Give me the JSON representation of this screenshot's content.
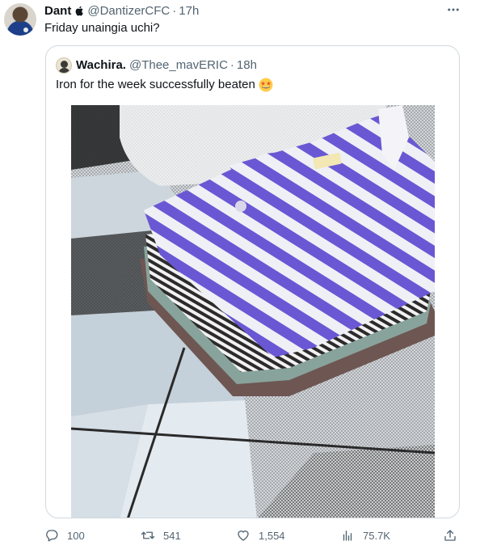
{
  "tweet": {
    "author_name": "Dant",
    "author_handle": "@DantizerCFC",
    "time": "17h",
    "separator": "·",
    "text": "Friday unaingia uchi?",
    "avatar_icon": "profile-photo-icon",
    "badge_icon": "apple-icon",
    "more_icon": "more-options-icon"
  },
  "quote": {
    "author_name": "Wachira.",
    "author_handle": "@Thee_mavERIC",
    "time": "18h",
    "separator": "·",
    "text": "Iron for the week successfully beaten",
    "emoji": "star-struck-emoji",
    "photo": "folded-ironed-shirts-photo"
  },
  "actions": {
    "reply": {
      "icon": "reply-icon",
      "count": "100"
    },
    "retweet": {
      "icon": "retweet-icon",
      "count": "541"
    },
    "like": {
      "icon": "heart-icon",
      "count": "1,554"
    },
    "views": {
      "icon": "views-icon",
      "count": "75.7K"
    },
    "share": {
      "icon": "share-icon"
    }
  },
  "colors": {
    "text_primary": "#0f1419",
    "text_secondary": "#536471",
    "border": "#cfd9de",
    "shirt_stripe": "#6a57d4"
  }
}
